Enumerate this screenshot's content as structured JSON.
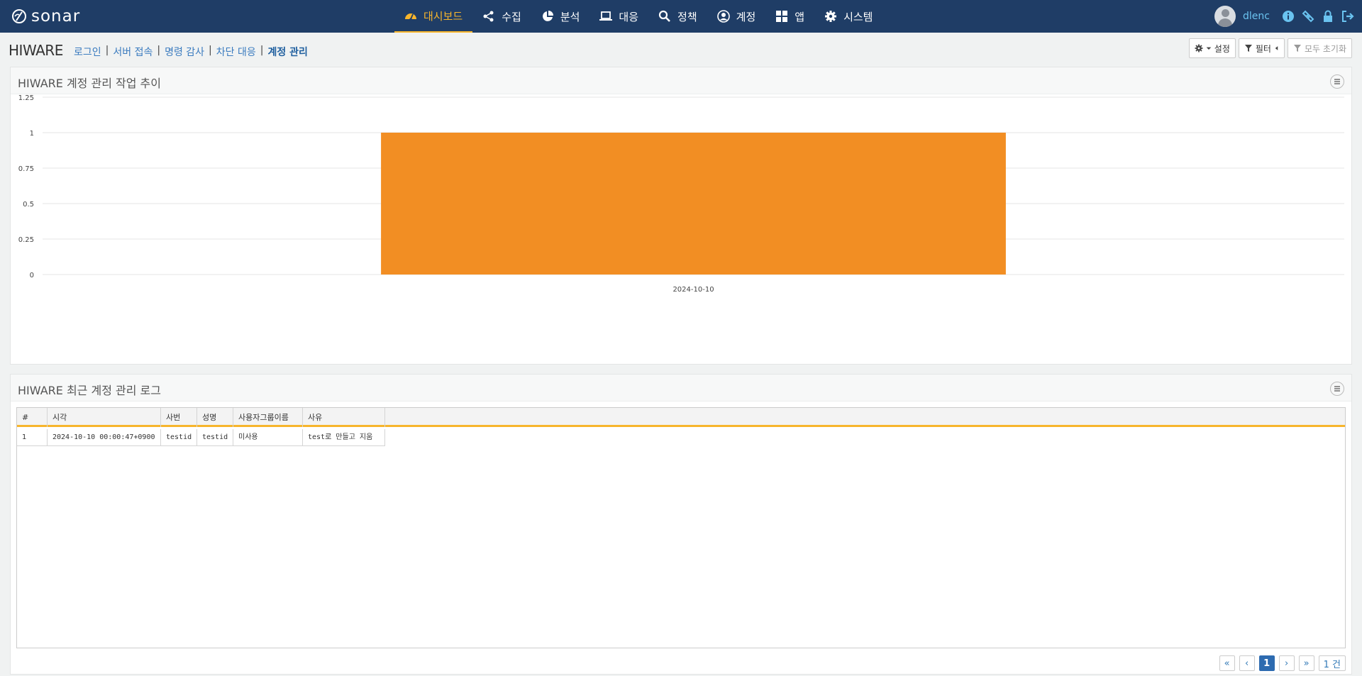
{
  "brand": {
    "name": "sonar"
  },
  "nav": [
    {
      "label": "대시보드",
      "icon": "dashboard-icon",
      "active": true
    },
    {
      "label": "수집",
      "icon": "share-icon"
    },
    {
      "label": "분석",
      "icon": "pie-chart-icon"
    },
    {
      "label": "대응",
      "icon": "laptop-icon"
    },
    {
      "label": "정책",
      "icon": "search-icon"
    },
    {
      "label": "계정",
      "icon": "user-circle-icon"
    },
    {
      "label": "앱",
      "icon": "apps-grid-icon"
    },
    {
      "label": "시스템",
      "icon": "gear-icon"
    }
  ],
  "user": {
    "name": "dlenc"
  },
  "page": {
    "title": "HIWARE",
    "breadcrumbs": [
      "로그인",
      "서버 접속",
      "명령 감사",
      "차단 대응",
      "계정 관리"
    ]
  },
  "toolbar": {
    "settings": "설정",
    "filter": "필터",
    "reset": "모두 초기화"
  },
  "chart_panel": {
    "title": "HIWARE 계정 관리 작업 추이"
  },
  "chart_data": {
    "type": "bar",
    "categories": [
      "2024-10-10"
    ],
    "values": [
      1
    ],
    "ylim": [
      0,
      1.25
    ],
    "yticks": [
      "0",
      "0.25",
      "0.5",
      "0.75",
      "1",
      "1.25"
    ],
    "color": "#f28e23",
    "grid": true
  },
  "table_panel": {
    "title": "HIWARE 최근 계정 관리 로그",
    "columns": [
      "#",
      "시각",
      "사번",
      "성명",
      "사용자그룹이름",
      "사유"
    ],
    "rows": [
      [
        "1",
        "2024-10-10 00:00:47+0900",
        "testid",
        "testid",
        "미사용",
        "test로 만들고 지움"
      ]
    ]
  },
  "pager": {
    "first": "«",
    "prev": "‹",
    "page": "1",
    "next": "›",
    "last": "»",
    "count": "1 건"
  }
}
